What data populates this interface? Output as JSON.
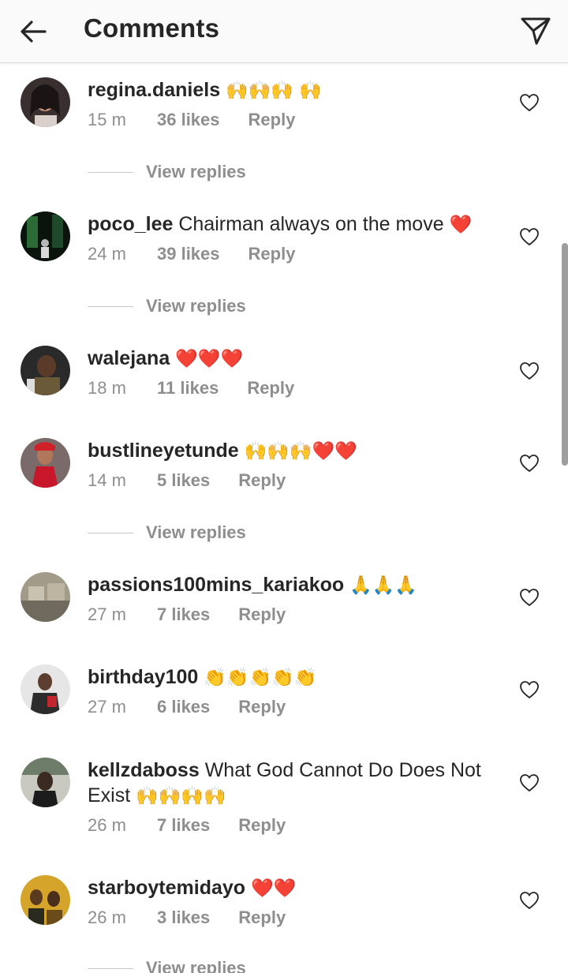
{
  "header": {
    "title": "Comments",
    "back_icon": "arrow-left-icon",
    "send_icon": "send-paper-plane-icon"
  },
  "comments": [
    {
      "username": "regina.daniels",
      "text": "",
      "emoji": "🙌🙌🙌 🙌",
      "time": "15 m",
      "likes": "36 likes",
      "reply": "Reply",
      "view_replies": "View replies"
    },
    {
      "username": "poco_lee",
      "text": "Chairman always on the move",
      "emoji": "❤️",
      "time": "24 m",
      "likes": "39 likes",
      "reply": "Reply",
      "view_replies": "View replies"
    },
    {
      "username": "walejana",
      "text": "",
      "emoji": "❤️❤️❤️",
      "time": "18 m",
      "likes": "11 likes",
      "reply": "Reply",
      "view_replies": ""
    },
    {
      "username": "bustlineyetunde",
      "text": "",
      "emoji": "🙌🙌🙌❤️❤️",
      "time": "14 m",
      "likes": "5 likes",
      "reply": "Reply",
      "view_replies": "View replies"
    },
    {
      "username": "passions100mins_kariakoo",
      "text": "",
      "emoji": "🙏🙏🙏",
      "time": "27 m",
      "likes": "7 likes",
      "reply": "Reply",
      "view_replies": ""
    },
    {
      "username": "birthday100",
      "text": "",
      "emoji": "👏👏👏👏👏",
      "time": "27 m",
      "likes": "6 likes",
      "reply": "Reply",
      "view_replies": ""
    },
    {
      "username": "kellzdaboss",
      "text": "What God Cannot Do Does Not Exist",
      "emoji": "🙌🙌🙌🙌",
      "time": "26 m",
      "likes": "7 likes",
      "reply": "Reply",
      "view_replies": ""
    },
    {
      "username": "starboytemidayo",
      "text": "",
      "emoji": "❤️❤️",
      "time": "26 m",
      "likes": "3 likes",
      "reply": "Reply",
      "view_replies": "View replies"
    }
  ],
  "colors": {
    "text": "#262626",
    "muted": "#8e8e8e",
    "heart_emoji": "#ed1c24",
    "divider": "#dbdbdb"
  }
}
